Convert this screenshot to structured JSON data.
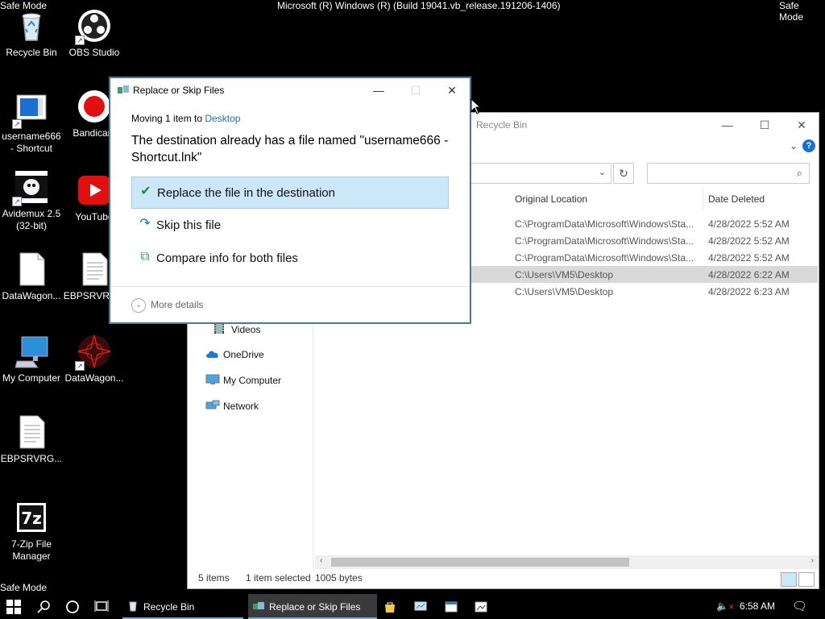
{
  "desktop": {
    "safe_mode_label": "Safe Mode",
    "os_build_text": "Microsoft (R) Windows (R) (Build 19041.vb_release.191206-1406)",
    "icons": [
      {
        "label": "Recycle Bin",
        "icon": "recycle-bin-icon"
      },
      {
        "label": "OBS Studio",
        "icon": "obs-icon"
      },
      {
        "label": "username666 - Shortcut",
        "icon": "shortcut-icon"
      },
      {
        "label": "Bandicam",
        "icon": "bandicam-icon"
      },
      {
        "label": "Avidemux 2.5 (32-bit)",
        "icon": "avidemux-icon"
      },
      {
        "label": "YouTube",
        "icon": "youtube-icon"
      },
      {
        "label": "DataWagon...",
        "icon": "file-icon"
      },
      {
        "label": "EBPSRVRG...",
        "icon": "document-icon"
      },
      {
        "label": "My Computer",
        "icon": "computer-icon"
      },
      {
        "label": "DataWagon...",
        "icon": "datawagon-icon"
      },
      {
        "label": "EBPSRVRG...",
        "icon": "document-icon"
      },
      {
        "label": "7-Zip File Manager",
        "icon": "7zip-icon"
      }
    ]
  },
  "explorer": {
    "title": "Recycle Bin",
    "columns": {
      "original_location": "Original Location",
      "date_deleted": "Date Deleted"
    },
    "rows": [
      {
        "location": "C:\\ProgramData\\Microsoft\\Windows\\Sta...",
        "date": "4/28/2022 5:52 AM",
        "selected": false
      },
      {
        "location": "C:\\ProgramData\\Microsoft\\Windows\\Sta...",
        "date": "4/28/2022 5:52 AM",
        "selected": false
      },
      {
        "location": "C:\\ProgramData\\Microsoft\\Windows\\Sta...",
        "date": "4/28/2022 5:52 AM",
        "selected": false
      },
      {
        "location": "C:\\Users\\VM5\\Desktop",
        "date": "4/28/2022 6:22 AM",
        "selected": true
      },
      {
        "location": "C:\\Users\\VM5\\Desktop",
        "date": "4/28/2022 6:23 AM",
        "selected": false
      }
    ],
    "nav": {
      "videos": "Videos",
      "onedrive": "OneDrive",
      "my_computer": "My Computer",
      "network": "Network"
    },
    "status": {
      "items": "5 items",
      "selected": "1 item selected",
      "size": "1005 bytes"
    }
  },
  "dialog": {
    "title": "Replace or Skip Files",
    "moving_prefix": "Moving 1 item to",
    "moving_dest": "Desktop",
    "heading": "The destination already has a file named \"username666 - Shortcut.lnk\"",
    "options": {
      "replace": "Replace the file in the destination",
      "skip": "Skip this file",
      "compare": "Compare info for both files"
    },
    "more_details": "More details"
  },
  "taskbar": {
    "items": [
      {
        "label": "Recycle Bin"
      },
      {
        "label": "Replace or Skip Files"
      }
    ],
    "clock": "6:58 AM"
  },
  "colors": {
    "accent": "#1e73be",
    "highlight": "#cce8f8",
    "link": "#1a6fb8"
  }
}
